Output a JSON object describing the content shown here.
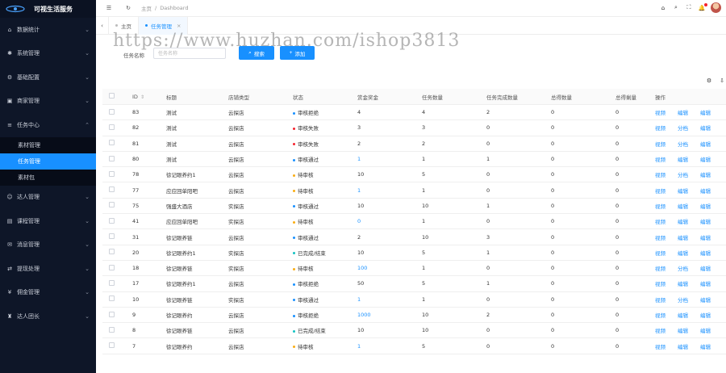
{
  "app": {
    "title": "可视生活服务"
  },
  "sidebar": {
    "items": [
      {
        "label": "数据统计",
        "icon": "home-icon"
      },
      {
        "label": "系统管理",
        "icon": "settings-icon"
      },
      {
        "label": "基础配置",
        "icon": "gear-icon"
      },
      {
        "label": "商家管理",
        "icon": "store-icon"
      },
      {
        "label": "任务中心",
        "icon": "task-icon"
      }
    ],
    "sub": [
      {
        "label": "素材管理"
      },
      {
        "label": "任务管理",
        "active": true
      },
      {
        "label": "素材包"
      }
    ],
    "items2": [
      {
        "label": "达人管理",
        "icon": "user-icon"
      },
      {
        "label": "课程管理",
        "icon": "course-icon"
      },
      {
        "label": "消息管理",
        "icon": "message-icon"
      },
      {
        "label": "提现处理",
        "icon": "withdraw-icon"
      },
      {
        "label": "佣金管理",
        "icon": "money-icon"
      },
      {
        "label": "达人团长",
        "icon": "team-icon"
      }
    ]
  },
  "header": {
    "breadcrumb": [
      "主页",
      "Dashboard"
    ]
  },
  "tabs": [
    {
      "label": "主页",
      "active": false
    },
    {
      "label": "任务管理",
      "active": true
    }
  ],
  "search": {
    "label": "任务名称",
    "placeholder": "任务名称",
    "search_label": "搜索",
    "add_label": "添加"
  },
  "table": {
    "columns": [
      "ID",
      "标题",
      "店铺类型",
      "状态",
      "赏金奖金",
      "任务数量",
      "任务完成数量",
      "总得数量",
      "总得剩量",
      "操作"
    ],
    "rows": [
      {
        "id": "83",
        "name": "测试",
        "type": "云探店",
        "status": "审核拒绝",
        "status_color": "#1890ff",
        "money": "4",
        "count": "4",
        "done": "2",
        "total": "0",
        "pay": "0",
        "ops": [
          "视频",
          "编辑",
          "编辑"
        ]
      },
      {
        "id": "82",
        "name": "测试",
        "type": "云探店",
        "status": "审核失败",
        "status_color": "#f5222d",
        "money": "3",
        "count": "3",
        "done": "0",
        "total": "0",
        "pay": "0",
        "ops": [
          "视频",
          "分档",
          "编辑"
        ]
      },
      {
        "id": "81",
        "name": "测试",
        "type": "云探店",
        "status": "审核失败",
        "status_color": "#f5222d",
        "money": "2",
        "count": "2",
        "done": "0",
        "total": "0",
        "pay": "0",
        "ops": [
          "视频",
          "分档",
          "编辑"
        ]
      },
      {
        "id": "80",
        "name": "测试",
        "type": "云探店",
        "status": "审核通过",
        "status_color": "#1890ff",
        "money": "1",
        "count": "1",
        "done": "1",
        "total": "0",
        "pay": "0",
        "ops": [
          "视频",
          "编辑",
          "编辑"
        ]
      },
      {
        "id": "78",
        "name": "徐记眼养约1",
        "type": "云探店",
        "status": "待审核",
        "status_color": "#faad14",
        "money": "10",
        "count": "5",
        "done": "0",
        "total": "0",
        "pay": "0",
        "ops": [
          "视频",
          "分档",
          "编辑"
        ]
      },
      {
        "id": "77",
        "name": "应应回单阳吧",
        "type": "云探店",
        "status": "待审核",
        "status_color": "#faad14",
        "money": "1",
        "count": "1",
        "done": "0",
        "total": "0",
        "pay": "0",
        "ops": [
          "视频",
          "编辑",
          "编辑"
        ]
      },
      {
        "id": "75",
        "name": "强盛大酒店",
        "type": "实探店",
        "status": "审核通过",
        "status_color": "#1890ff",
        "money": "10",
        "count": "10",
        "done": "1",
        "total": "0",
        "pay": "0",
        "ops": [
          "视频",
          "编辑",
          "编辑"
        ]
      },
      {
        "id": "41",
        "name": "应应回单阳吧",
        "type": "实探店",
        "status": "待审核",
        "status_color": "#faad14",
        "money": "0",
        "count": "1",
        "done": "0",
        "total": "0",
        "pay": "0",
        "ops": [
          "视频",
          "编辑",
          "编辑"
        ]
      },
      {
        "id": "31",
        "name": "徐记眼养链",
        "type": "云探店",
        "status": "审核通过",
        "status_color": "#1890ff",
        "money": "2",
        "count": "10",
        "done": "3",
        "total": "0",
        "pay": "0",
        "ops": [
          "视频",
          "编辑",
          "编辑"
        ]
      },
      {
        "id": "20",
        "name": "徐记眼养约1",
        "type": "实探店",
        "status": "已完成/结束",
        "status_color": "#13c2c2",
        "money": "10",
        "count": "5",
        "done": "1",
        "total": "0",
        "pay": "0",
        "ops": [
          "视频",
          "编辑",
          "编辑"
        ]
      },
      {
        "id": "18",
        "name": "徐记眼养链",
        "type": "实探店",
        "status": "待审核",
        "status_color": "#faad14",
        "money": "100",
        "count": "1",
        "done": "0",
        "total": "0",
        "pay": "0",
        "ops": [
          "视频",
          "分档",
          "编辑"
        ]
      },
      {
        "id": "17",
        "name": "徐记眼养约1",
        "type": "云探店",
        "status": "审核拒绝",
        "status_color": "#1890ff",
        "money": "50",
        "count": "5",
        "done": "1",
        "total": "0",
        "pay": "0",
        "ops": [
          "视频",
          "编辑",
          "编辑"
        ]
      },
      {
        "id": "10",
        "name": "徐记眼养链",
        "type": "实探店",
        "status": "审核通过",
        "status_color": "#1890ff",
        "money": "1",
        "count": "1",
        "done": "0",
        "total": "0",
        "pay": "0",
        "ops": [
          "视频",
          "分档",
          "编辑"
        ]
      },
      {
        "id": "9",
        "name": "徐记眼养约",
        "type": "云探店",
        "status": "审核拒绝",
        "status_color": "#1890ff",
        "money": "1000",
        "count": "10",
        "done": "2",
        "total": "0",
        "pay": "0",
        "ops": [
          "视频",
          "编辑",
          "编辑"
        ]
      },
      {
        "id": "8",
        "name": "徐记眼养链",
        "type": "云探店",
        "status": "已完成/结束",
        "status_color": "#13c2c2",
        "money": "10",
        "count": "10",
        "done": "0",
        "total": "0",
        "pay": "0",
        "ops": [
          "视频",
          "编辑",
          "编辑"
        ]
      },
      {
        "id": "7",
        "name": "徐记眼养约",
        "type": "云探店",
        "status": "待审核",
        "status_color": "#faad14",
        "money": "1",
        "count": "5",
        "done": "0",
        "total": "0",
        "pay": "0",
        "ops": [
          "视频",
          "编辑",
          "编辑"
        ]
      }
    ]
  },
  "watermark": "https://www.huzhan.com/ishop3813",
  "colors": {
    "sidebar_bg": "#0e1628",
    "accent": "#1890ff"
  }
}
